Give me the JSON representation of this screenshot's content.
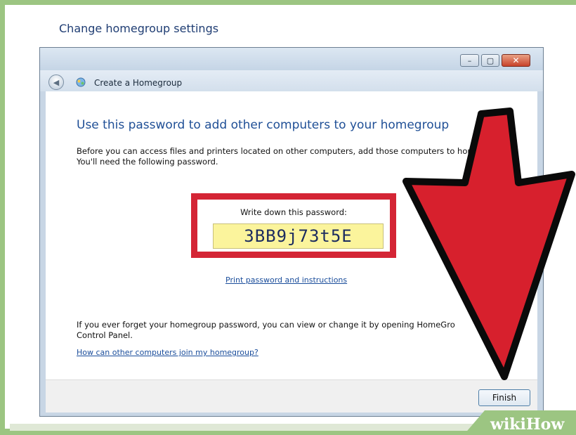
{
  "page": {
    "title": "Change homegroup settings"
  },
  "window": {
    "controls": {
      "minimize": "–",
      "maximize": "▢",
      "close": "✕"
    },
    "nav_title": "Create a Homegroup",
    "heading": "Use this password to add other computers to your homegroup",
    "description": "Before you can access files and printers located on other computers, add those computers to homegroup. You'll need the following password.",
    "password_label": "Write down this password:",
    "password": "3BB9j73t5E",
    "print_link": "Print password and instructions",
    "forget_text": "If you ever forget your homegroup password, you can view or change it by opening HomeGro Control Panel.",
    "join_link": "How can other computers join my homegroup?",
    "finish_label": "Finish"
  },
  "overlay": {
    "arrow_icon": "red-down-arrow-icon",
    "arrow_color": "#d7202d",
    "watermark": "wikiHow"
  }
}
